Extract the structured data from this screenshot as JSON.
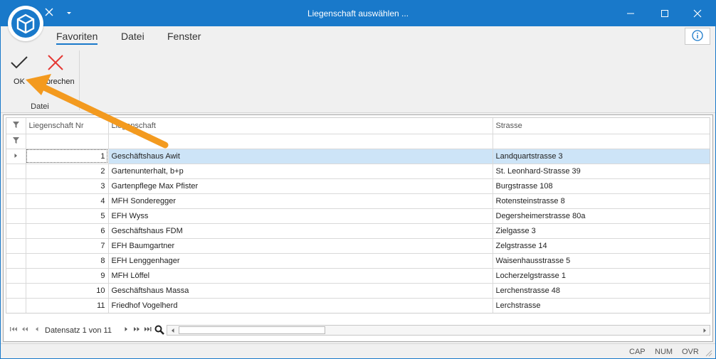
{
  "window": {
    "title": "Liegenschaft auswählen ..."
  },
  "ribbon": {
    "tabs": [
      {
        "label": "Favoriten",
        "active": true
      },
      {
        "label": "Datei",
        "active": false
      },
      {
        "label": "Fenster",
        "active": false
      }
    ],
    "ok_label": "OK",
    "cancel_label": "Abbrechen",
    "group_label": "Datei"
  },
  "grid": {
    "columns": [
      "Liegenschaft Nr",
      "Liegenschaft",
      "Strasse"
    ],
    "rows": [
      {
        "nr": "1",
        "name": "Geschäftshaus Awit",
        "street": "Landquartstrasse 3",
        "selected": true
      },
      {
        "nr": "2",
        "name": "Gartenunterhalt, b+p",
        "street": "St. Leonhard-Strasse 39",
        "selected": false
      },
      {
        "nr": "3",
        "name": "Gartenpflege Max Pfister",
        "street": "Burgstrasse 108",
        "selected": false
      },
      {
        "nr": "4",
        "name": "MFH Sonderegger",
        "street": "Rotensteinstrasse 8",
        "selected": false
      },
      {
        "nr": "5",
        "name": "EFH Wyss",
        "street": "Degersheimerstrasse 80a",
        "selected": false
      },
      {
        "nr": "6",
        "name": "Geschäftshaus FDM",
        "street": "Zielgasse 3",
        "selected": false
      },
      {
        "nr": "7",
        "name": "EFH Baumgartner",
        "street": "Zelgstrasse 14",
        "selected": false
      },
      {
        "nr": "8",
        "name": "EFH Lenggenhager",
        "street": "Waisenhausstrasse 5",
        "selected": false
      },
      {
        "nr": "9",
        "name": "MFH Löffel",
        "street": "Locherzelgstrasse 1",
        "selected": false
      },
      {
        "nr": "10",
        "name": "Geschäftshaus Massa",
        "street": "Lerchenstrasse 48",
        "selected": false
      },
      {
        "nr": "11",
        "name": "Friedhof Vogelherd",
        "street": "Lerchstrasse",
        "selected": false
      }
    ],
    "navigator_text": "Datensatz 1 von 11"
  },
  "statusbar": {
    "cap": "CAP",
    "num": "NUM",
    "ovr": "OVR"
  },
  "colors": {
    "accent": "#1979ca",
    "selection": "#cde4f7",
    "cancel": "#e53935",
    "annotation_arrow": "#f39a1f"
  }
}
